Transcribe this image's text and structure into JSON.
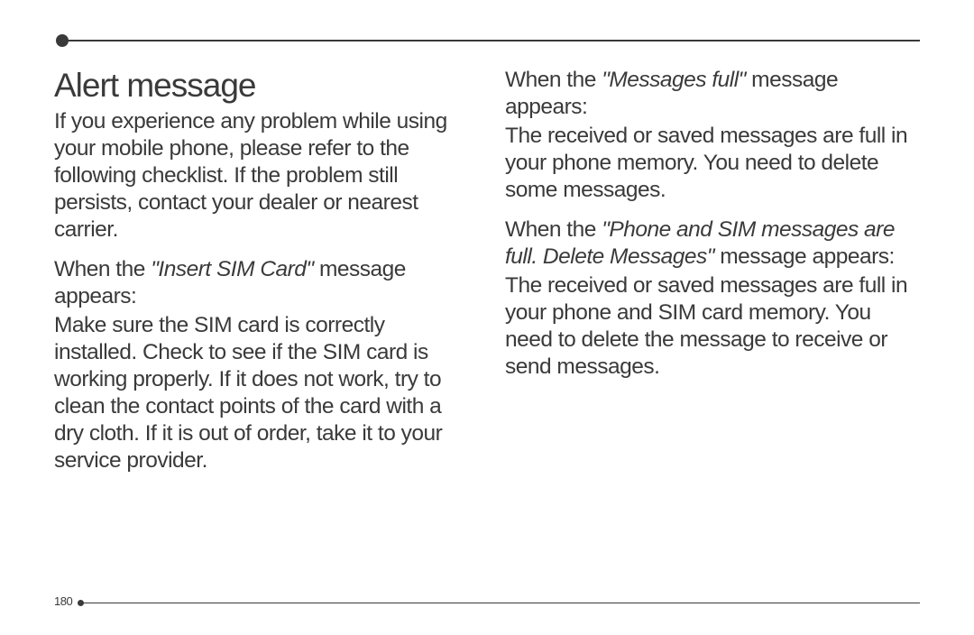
{
  "page_number": "180",
  "col1": {
    "heading": "Alert message",
    "intro": "If you experience any problem while using your mobile phone, please refer to the following checklist. If the problem still persists, contact your dealer or nearest carrier.",
    "sub1_pre": "When the ",
    "sub1_em": "\"Insert SIM Card\"",
    "sub1_post": " message appears:",
    "body1": "Make sure the SIM card is correctly installed. Check to see if the SIM card is working properly. If it does not work, try to clean the contact points of the card with a dry cloth. If it is out of order, take it to your service provider."
  },
  "col2": {
    "sub1_pre": "When the ",
    "sub1_em": "\"Messages full\"",
    "sub1_post": " message appears:",
    "body1": "The received or saved messages are full in your phone memory. You need to delete some messages.",
    "sub2_pre": "When the ",
    "sub2_em": "\"Phone and SIM messages are full. Delete Messages\"",
    "sub2_post": " message appears:",
    "body2": "The received or saved messages are full in your phone and SIM card memory. You need to delete the message to receive or send messages."
  }
}
